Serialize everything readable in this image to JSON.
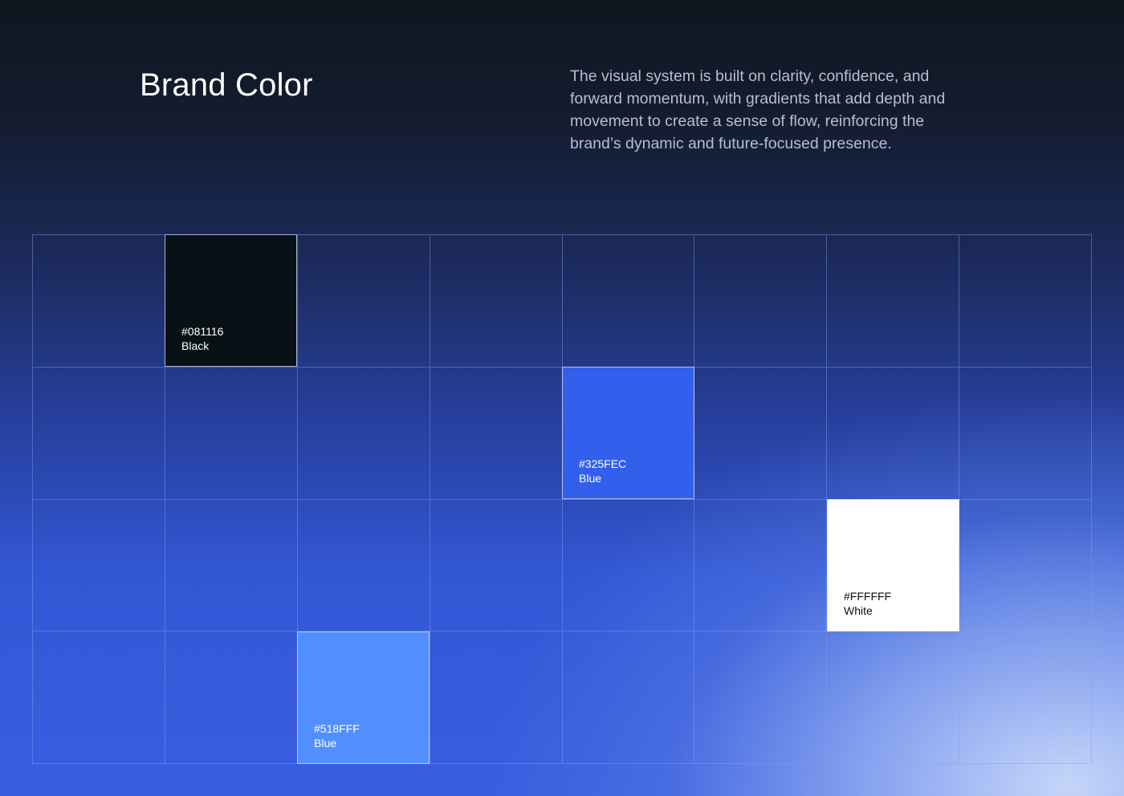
{
  "header": {
    "title": "Brand Color",
    "description": "The visual system is built on clarity, confidence, and forward momentum, with gradients that add depth and movement to create a sense of flow, reinforcing the brand’s dynamic and future-focused presence."
  },
  "swatches": [
    {
      "hex": "#081116",
      "name": "Black",
      "color": "#081116",
      "text_color": "#ffffff"
    },
    {
      "hex": "#325FEC",
      "name": "Blue",
      "color": "#325FEC",
      "text_color": "#ffffff"
    },
    {
      "hex": "#FFFFFF",
      "name": "White",
      "color": "#FFFFFF",
      "text_color": "#081116"
    },
    {
      "hex": "#518FFF",
      "name": "Blue",
      "color": "#518FFF",
      "text_color": "#ffffff"
    }
  ]
}
